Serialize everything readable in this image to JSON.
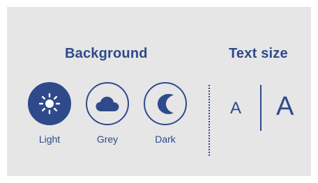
{
  "background": {
    "heading": "Background",
    "options": [
      {
        "label": "Light",
        "icon": "sun-icon",
        "selected": true
      },
      {
        "label": "Grey",
        "icon": "cloud-icon",
        "selected": false
      },
      {
        "label": "Dark",
        "icon": "moon-icon",
        "selected": false
      }
    ]
  },
  "text_size": {
    "heading": "Text size",
    "small_label": "A",
    "large_label": "A"
  },
  "colors": {
    "accent": "#2e4a8b",
    "panel": "#e6e6e6",
    "page": "#ffffff"
  }
}
